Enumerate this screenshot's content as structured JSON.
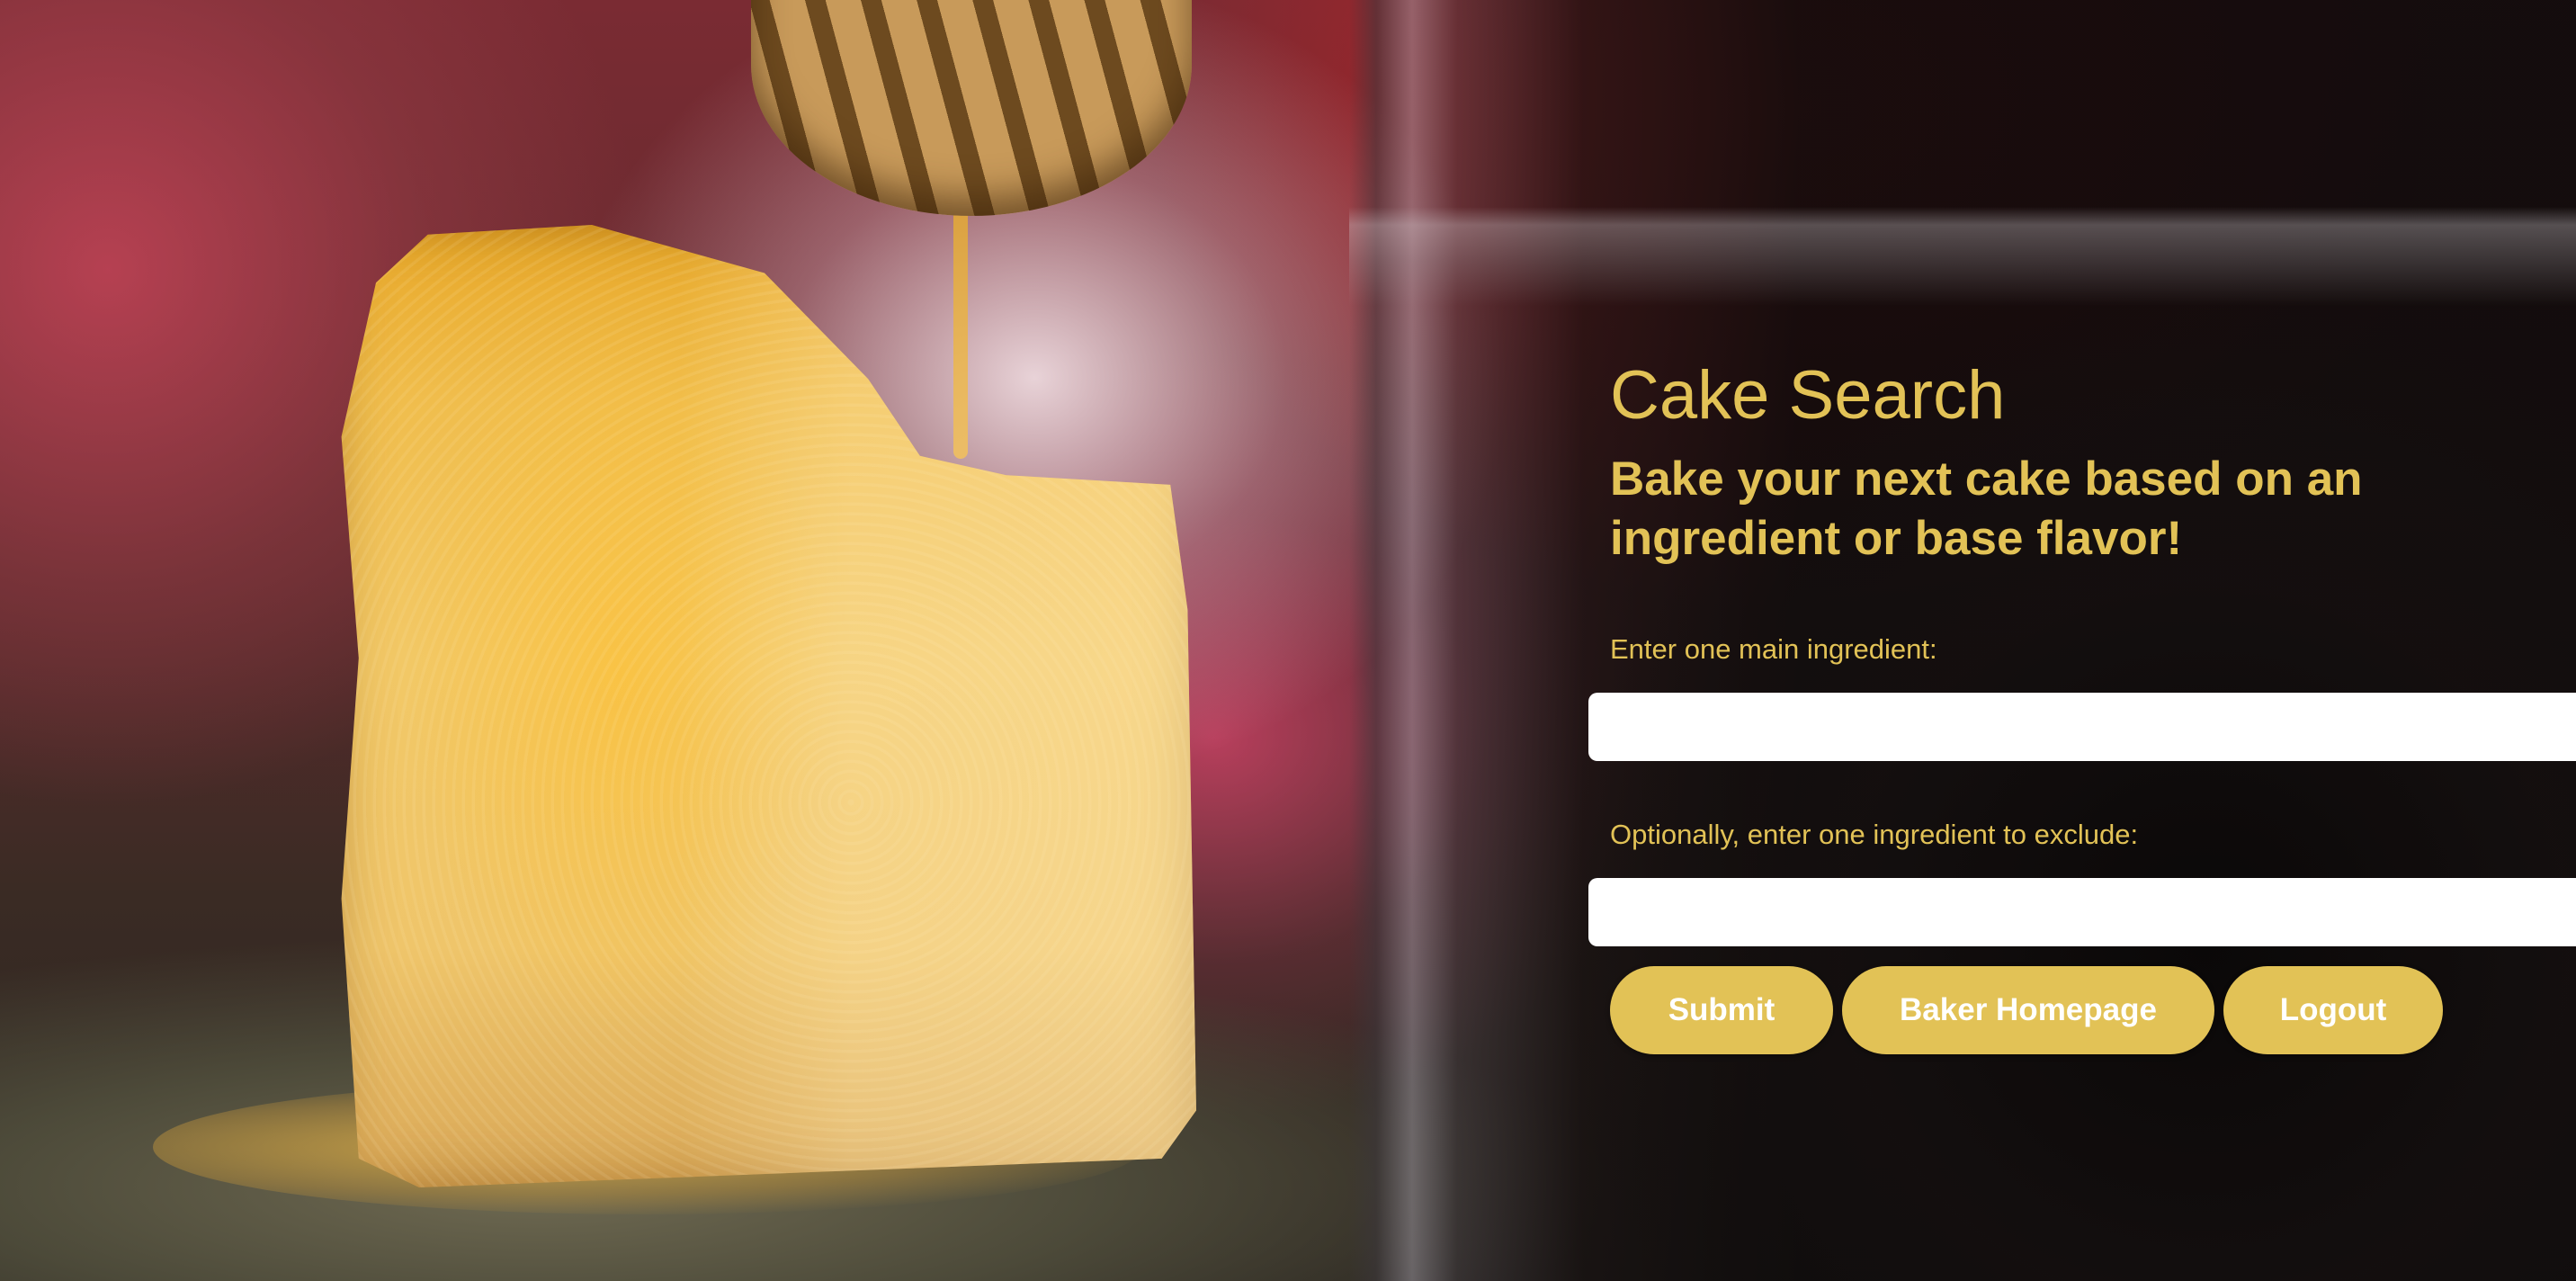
{
  "page": {
    "title": "Cake Search",
    "subtitle": "Bake your next cake based on an ingredient or base flavor!"
  },
  "form": {
    "ingredient_label": "Enter one main ingredient:",
    "ingredient_value": "",
    "exclude_label": "Optionally, enter one ingredient to exclude:",
    "exclude_value": ""
  },
  "buttons": {
    "submit": "Submit",
    "baker_homepage": "Baker Homepage",
    "logout": "Logout"
  },
  "colors": {
    "accent": "#e2c256",
    "button_text": "#ffffff",
    "input_background": "#ffffff"
  },
  "background": {
    "subject": "honey-drizzled-cake-slice-photo"
  }
}
